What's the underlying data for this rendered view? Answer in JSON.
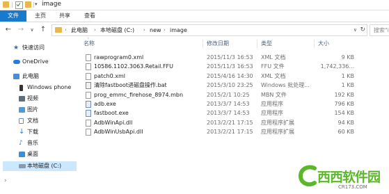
{
  "window": {
    "title": "image"
  },
  "ribbon": {
    "tabs": [
      "文件",
      "主页",
      "共享",
      "查看"
    ]
  },
  "address": {
    "breadcrumbs": [
      "此电脑",
      "本地磁盘 (C:)",
      "new",
      "image"
    ],
    "search_placeholder": "搜索\"image\""
  },
  "nav_pane": {
    "items": [
      {
        "label": "快速访问",
        "icon": "star-icon"
      },
      {
        "label": "OneDrive",
        "icon": "cloud-icon"
      },
      {
        "label": "此电脑",
        "icon": "computer-icon"
      },
      {
        "label": "Windows phone",
        "icon": "phone-icon"
      },
      {
        "label": "视频",
        "icon": "video-icon"
      },
      {
        "label": "图片",
        "icon": "picture-icon"
      },
      {
        "label": "文档",
        "icon": "document-icon"
      },
      {
        "label": "下载",
        "icon": "download-icon"
      },
      {
        "label": "音乐",
        "icon": "music-icon"
      },
      {
        "label": "桌面",
        "icon": "desktop-icon"
      },
      {
        "label": "本地磁盘 (C:)",
        "icon": "drive-icon",
        "selected": true
      }
    ]
  },
  "file_list": {
    "columns": [
      "名称",
      "修改日期",
      "类型",
      "大小"
    ],
    "rows": [
      {
        "name": "rawprogram0.xml",
        "date": "2015/11/3 16:53",
        "type": "XML 文档",
        "size": "9 KB",
        "kind": "xml"
      },
      {
        "name": "10586.1102.3063.Retail.FFU",
        "date": "2015/11/3 16:53",
        "type": "FFU 文件",
        "size": "1,742,336...",
        "kind": "ffu"
      },
      {
        "name": "patch0.xml",
        "date": "2015/4/16 14:30",
        "type": "XML 文档",
        "size": "1 KB",
        "kind": "xml"
      },
      {
        "name": "清除fastboot进磁盘操作.bat",
        "date": "2015/3/10 23:25",
        "type": "Windows 批处理...",
        "size": "1 KB",
        "kind": "bat"
      },
      {
        "name": "prog_emmc_firehose_8974.mbn",
        "date": "2015/2/1 10:25",
        "type": "MBN 文件",
        "size": "192 KB",
        "kind": "mbn"
      },
      {
        "name": "adb.exe",
        "date": "2013/3/7 14:53",
        "type": "应用程序",
        "size": "796 KB",
        "kind": "exe"
      },
      {
        "name": "fastboot.exe",
        "date": "2013/3/7 14:53",
        "type": "应用程序",
        "size": "154 KB",
        "kind": "exe"
      },
      {
        "name": "AdbWinApi.dll",
        "date": "2013/2/21 17:15",
        "type": "应用程序扩展",
        "size": "94 KB",
        "kind": "dll"
      },
      {
        "name": "AdbWinUsbApi.dll",
        "date": "2013/2/21 17:15",
        "type": "应用程序扩展",
        "size": "60 KB",
        "kind": "dll"
      }
    ]
  },
  "watermark": {
    "text": "西西软件园",
    "sub": "CR173.COM"
  }
}
